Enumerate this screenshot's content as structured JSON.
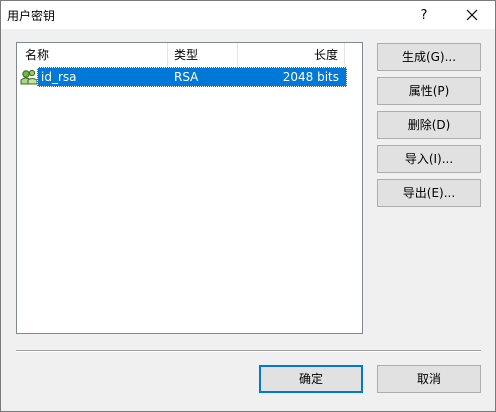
{
  "window": {
    "title": "用户密钥",
    "help_label": "?"
  },
  "list": {
    "columns": [
      "名称",
      "类型",
      "长度"
    ],
    "rows": [
      {
        "name": "id_rsa",
        "type": "RSA",
        "length": "2048 bits",
        "selected": true
      }
    ]
  },
  "buttons": {
    "generate": "生成(G)...",
    "properties": "属性(P)",
    "delete": "删除(D)",
    "import": "导入(I)...",
    "export": "导出(E)...",
    "ok": "确定",
    "cancel": "取消"
  },
  "colors": {
    "selection": "#0078d7",
    "default_button_border": "#0078d7"
  },
  "icons": {
    "key": "key-pair-icon",
    "close": "close-icon"
  }
}
